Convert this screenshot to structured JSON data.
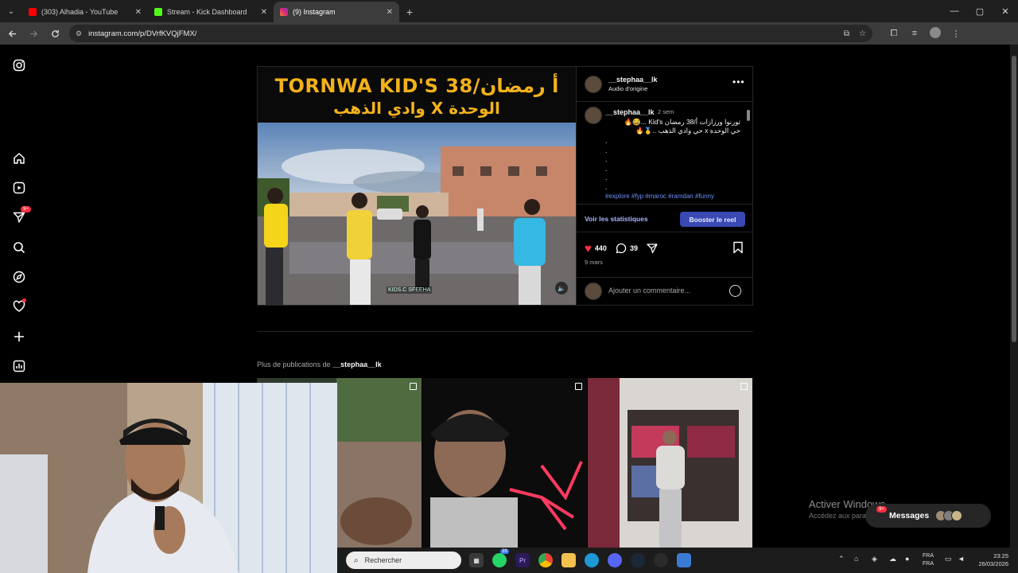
{
  "browser": {
    "tabs": [
      {
        "title": "(303) Alhadia - YouTube",
        "favicon_color": "#ff0000",
        "active": false
      },
      {
        "title": "Stream - Kick Dashboard",
        "favicon_color": "#53fc18",
        "active": false
      },
      {
        "title": "(9) Instagram",
        "favicon_color": "#e1306c",
        "active": true
      }
    ],
    "new_tab": "+",
    "url": "instagram.com/p/DVrfKVQjFMX/",
    "window_controls": [
      "—",
      "▢",
      "✕"
    ]
  },
  "sidebar": {
    "notifications_badge": "9+",
    "items": [
      "instagram-logo",
      "home",
      "reels",
      "messages",
      "search",
      "explore",
      "notifications",
      "create",
      "dashboard"
    ]
  },
  "post": {
    "media": {
      "title_line1": "TORNWA KID'S 38/أ رمضان",
      "title_line2": "وادي الذهب X الوحدة",
      "watermark": "KIDS.C SFEEHA"
    },
    "header": {
      "username": "__stephaa__lk",
      "audio": "Audio d'origine"
    },
    "caption": {
      "username": "__stephaa__lk",
      "time": "2 sem",
      "line1": "تورنوا ورزازات أ/38 رمضان Kid's ...😂🔥",
      "line2": "حي الوحدة x حي وادي الذهب ..🥇🔥",
      "dots": [
        ".",
        ".",
        ".",
        ".",
        ".",
        ".",
        "."
      ],
      "hashtags": "#explore #fyp #maroc #ramdan #funny"
    },
    "actions": {
      "stats_link": "Voir les statistiques",
      "boost_button": "Booster le reel"
    },
    "likes": "440",
    "comments": "39",
    "date": "9 mars",
    "comment_placeholder": "Ajouter un commentaire..."
  },
  "more_posts": {
    "prefix": "Plus de publications de",
    "username": "__stephaa__lk"
  },
  "messages_pill": {
    "label": "Messages",
    "badge": "9+"
  },
  "windows_activation": {
    "title": "Activer Windows",
    "subtitle": "Accédez aux paramètres pour activer Windows."
  },
  "taskbar": {
    "search_placeholder": "Rechercher",
    "whatsapp_badge": "39",
    "lang_line1": "FRA",
    "lang_line2": "FRA",
    "time": "23:25",
    "date": "26/03/2026"
  },
  "colors": {
    "accent_blue": "#3a49b4",
    "like_red": "#ff3040",
    "title_gold": "#f3b21a",
    "link_blue": "#a8b6ff"
  }
}
